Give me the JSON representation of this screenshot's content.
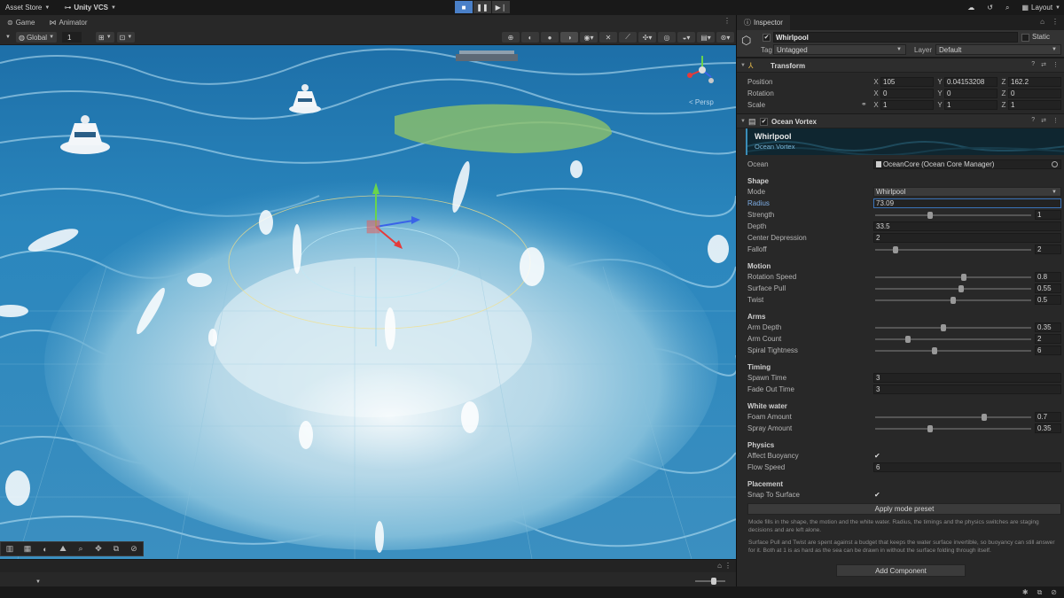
{
  "topbar": {
    "asset_store": "Asset Store",
    "vcs": "Unity VCS",
    "layout": "Layout",
    "icons": [
      "cloud-icon",
      "history-icon",
      "search-icon"
    ]
  },
  "scene": {
    "tabs": [
      {
        "label": "Game",
        "icon": "gamepad-icon"
      },
      {
        "label": "Animator",
        "icon": "animator-icon"
      }
    ],
    "toolbar": {
      "pivot_mode": "Global",
      "grid_size": "1"
    },
    "persp": "< Persp"
  },
  "inspector": {
    "tab_label": "Inspector",
    "object_name": "Whirlpool",
    "static_label": "Static",
    "tag_label": "Tag",
    "tag_value": "Untagged",
    "layer_label": "Layer",
    "layer_value": "Default",
    "transform": {
      "title": "Transform",
      "position": {
        "label": "Position",
        "x": "105",
        "y": "0.04153208",
        "z": "162.2"
      },
      "rotation": {
        "label": "Rotation",
        "x": "0",
        "y": "0",
        "z": "0"
      },
      "scale": {
        "label": "Scale",
        "x": "1",
        "y": "1",
        "z": "1"
      }
    },
    "vortex": {
      "title": "Ocean Vortex",
      "banner_title": "Whirlpool",
      "banner_sub": "Ocean Vortex",
      "ocean_label": "Ocean",
      "ocean_value": "OceanCore (Ocean Core Manager)",
      "shape": {
        "header": "Shape",
        "mode_label": "Mode",
        "mode_value": "Whirlpool",
        "radius_label": "Radius",
        "radius_value": "73.09",
        "strength_label": "Strength",
        "strength_value": "1",
        "strength_frac": 0.35,
        "depth_label": "Depth",
        "depth_value": "33.5",
        "center_label": "Center Depression",
        "center_value": "2",
        "falloff_label": "Falloff",
        "falloff_value": "2",
        "falloff_frac": 0.13
      },
      "motion": {
        "header": "Motion",
        "rot_label": "Rotation Speed",
        "rot_value": "0.8",
        "rot_frac": 0.57,
        "pull_label": "Surface Pull",
        "pull_value": "0.55",
        "pull_frac": 0.55,
        "twist_label": "Twist",
        "twist_value": "0.5",
        "twist_frac": 0.5
      },
      "arms": {
        "header": "Arms",
        "depth_label": "Arm Depth",
        "depth_value": "0.35",
        "depth_frac": 0.44,
        "count_label": "Arm Count",
        "count_value": "2",
        "count_frac": 0.21,
        "spiral_label": "Spiral Tightness",
        "spiral_value": "6",
        "spiral_frac": 0.38
      },
      "timing": {
        "header": "Timing",
        "spawn_label": "Spawn Time",
        "spawn_value": "3",
        "fade_label": "Fade Out Time",
        "fade_value": "3"
      },
      "white_water": {
        "header": "White water",
        "foam_label": "Foam Amount",
        "foam_value": "0.7",
        "foam_frac": 0.7,
        "spray_label": "Spray Amount",
        "spray_value": "0.35",
        "spray_frac": 0.35
      },
      "physics": {
        "header": "Physics",
        "buoy_label": "Affect Buoyancy",
        "buoy_checked": "✔",
        "flow_label": "Flow Speed",
        "flow_value": "6"
      },
      "placement": {
        "header": "Placement",
        "snap_label": "Snap To Surface",
        "snap_checked": "✔"
      },
      "apply_button": "Apply mode preset",
      "note1": "Mode fills in the shape, the motion and the white water. Radius, the timings and the physics switches are staging decisions and are left alone.",
      "note2": "Surface Pull and Twist are spent against a budget that keeps the water surface invertible, so buoyancy can still answer for it. Both at 1 is as hard as the sea can be drawn in without the surface folding through itself."
    },
    "add_component": "Add Component"
  },
  "colors": {
    "accent": "#4a80c8",
    "water": "#2f82b3",
    "foam": "#dbeef5"
  }
}
